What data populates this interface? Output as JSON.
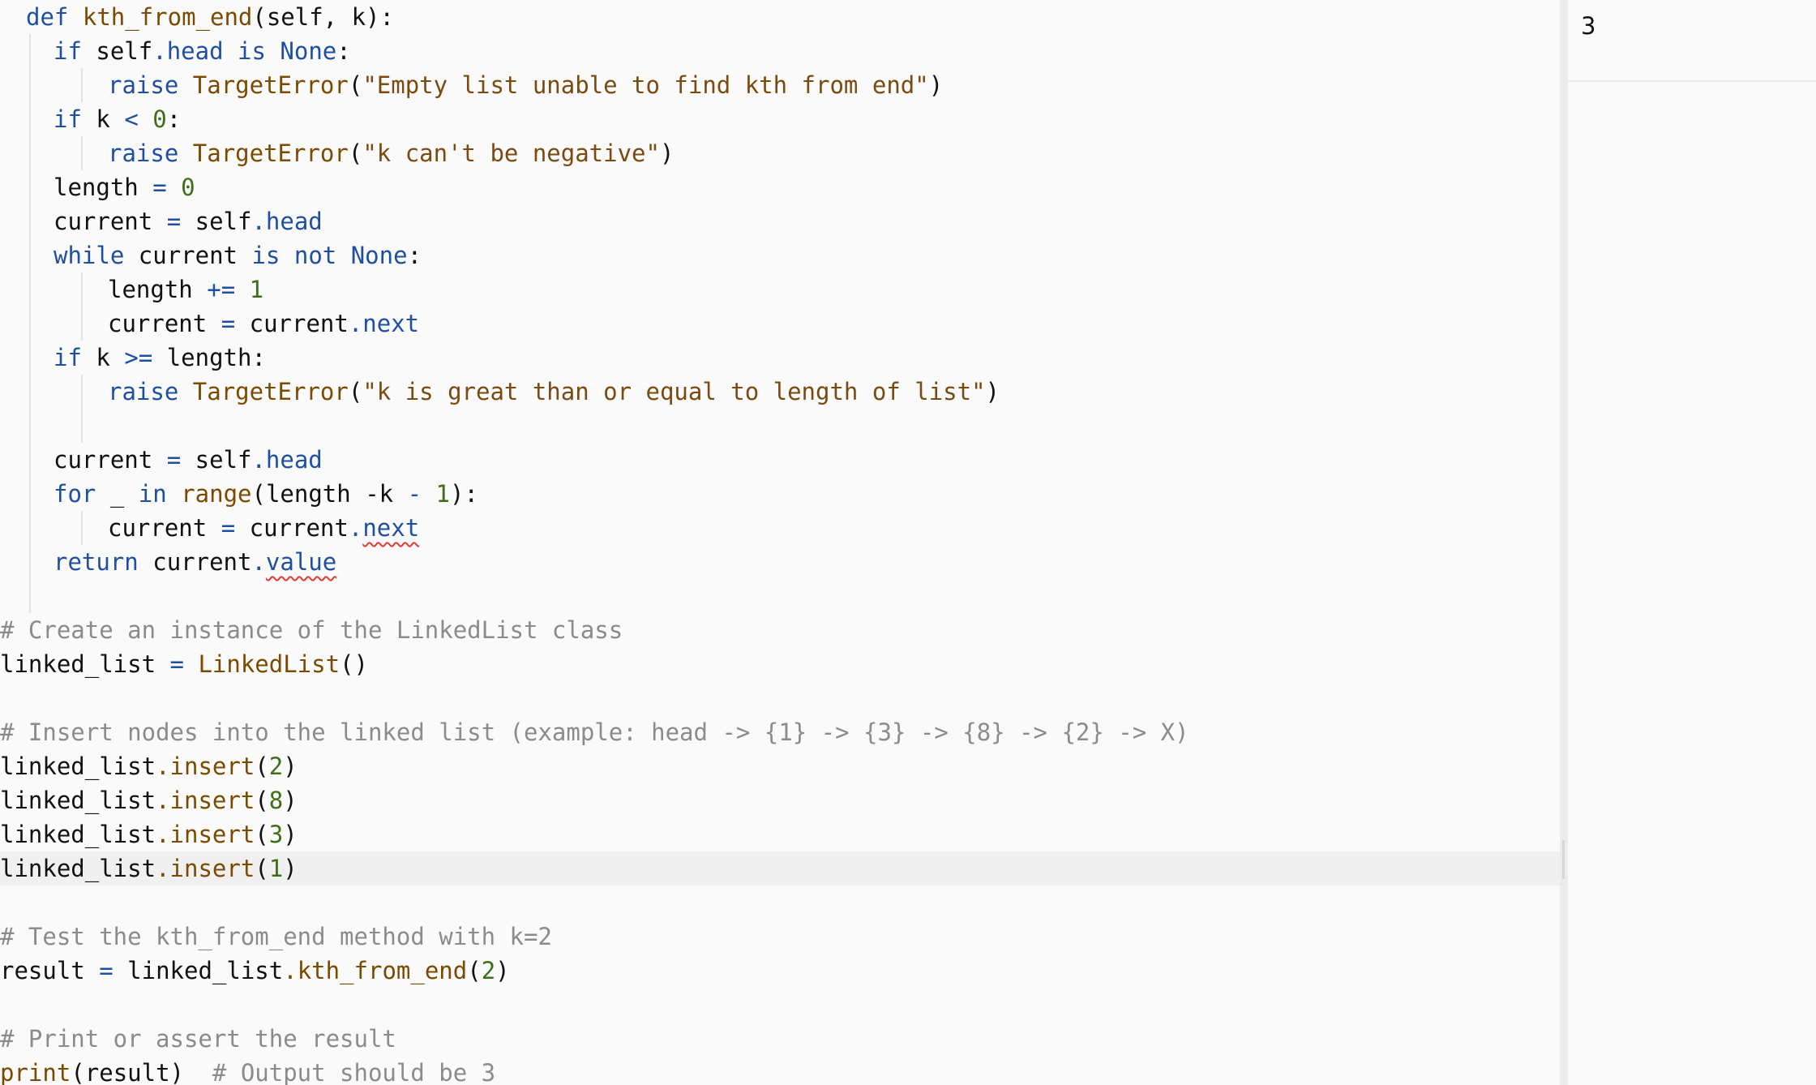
{
  "editor": {
    "lines": {
      "l1": {
        "kw1": "def",
        "fn": "kth_from_end",
        "rest": "(self, k):"
      },
      "l2": {
        "kw1": "if",
        "a": "self",
        "attr": ".head",
        "kw2": "is",
        "kw3": "None",
        "rest": ":"
      },
      "l3": {
        "kw1": "raise",
        "fn": "TargetError",
        "p1": "(",
        "str": "\"Empty list unable to find kth from end\"",
        "p2": ")"
      },
      "l4": {
        "kw1": "if",
        "a": "k",
        "op": "<",
        "num": "0",
        "rest": ":"
      },
      "l5": {
        "kw1": "raise",
        "fn": "TargetError",
        "p1": "(",
        "str": "\"k can't be negative\"",
        "p2": ")"
      },
      "l6": {
        "a": "length",
        "op": "=",
        "num": "0"
      },
      "l7": {
        "a": "current",
        "op": "=",
        "b": "self",
        "attr": ".head"
      },
      "l8": {
        "kw1": "while",
        "a": "current",
        "kw2": "is",
        "kw3": "not",
        "kw4": "None",
        "rest": ":"
      },
      "l9": {
        "a": "length",
        "op": "+=",
        "num": "1"
      },
      "l10": {
        "a": "current",
        "op": "=",
        "b": "current",
        "attr": ".next"
      },
      "l11": {
        "kw1": "if",
        "a": "k",
        "op": ">=",
        "rest": "length:"
      },
      "l12": {
        "kw1": "raise",
        "fn": "TargetError",
        "p1": "(",
        "str": "\"k is great than or equal to length of list\"",
        "p2": ")"
      },
      "l14": {
        "a": "current",
        "op": "=",
        "b": "self",
        "attr": ".head"
      },
      "l15": {
        "kw1": "for",
        "a": "_",
        "kw2": "in",
        "fn": "range",
        "b": "(length",
        "op1": "-k",
        "op2": "-",
        "num": "1",
        "rest": "):"
      },
      "l16": {
        "a": "current",
        "op": "=",
        "b": "current",
        "dot": ".",
        "attr": "next"
      },
      "l17": {
        "kw1": "return",
        "a": "current",
        "dot": ".",
        "attr": "value"
      },
      "l19": {
        "cm": "# Create an instance of the LinkedList class"
      },
      "l20": {
        "a": "linked_list",
        "op": "=",
        "fn": "LinkedList",
        "rest": "()"
      },
      "l22": {
        "cm": "# Insert nodes into the linked list (example: head -> {1} -> {3} -> {8} -> {2} -> X)"
      },
      "l23": {
        "a": "linked_list",
        "fn": ".insert",
        "p1": "(",
        "num": "2",
        "p2": ")"
      },
      "l24": {
        "a": "linked_list",
        "fn": ".insert",
        "p1": "(",
        "num": "8",
        "p2": ")"
      },
      "l25": {
        "a": "linked_list",
        "fn": ".insert",
        "p1": "(",
        "num": "3",
        "p2": ")"
      },
      "l26": {
        "a": "linked_list",
        "fn": ".insert",
        "p1": "(",
        "num": "1",
        "p2": ")"
      },
      "l28": {
        "cm": "# Test the kth_from_end method with k=2"
      },
      "l29": {
        "a": "result",
        "op": "=",
        "b": "linked_list",
        "fn": ".kth_from_end",
        "p1": "(",
        "num": "2",
        "p2": ")"
      },
      "l31": {
        "cm": "# Print or assert the result"
      },
      "l32": {
        "fn": "print",
        "rest": "(result)",
        "cm": "# Output should be 3"
      }
    }
  },
  "output": {
    "value": "3"
  }
}
